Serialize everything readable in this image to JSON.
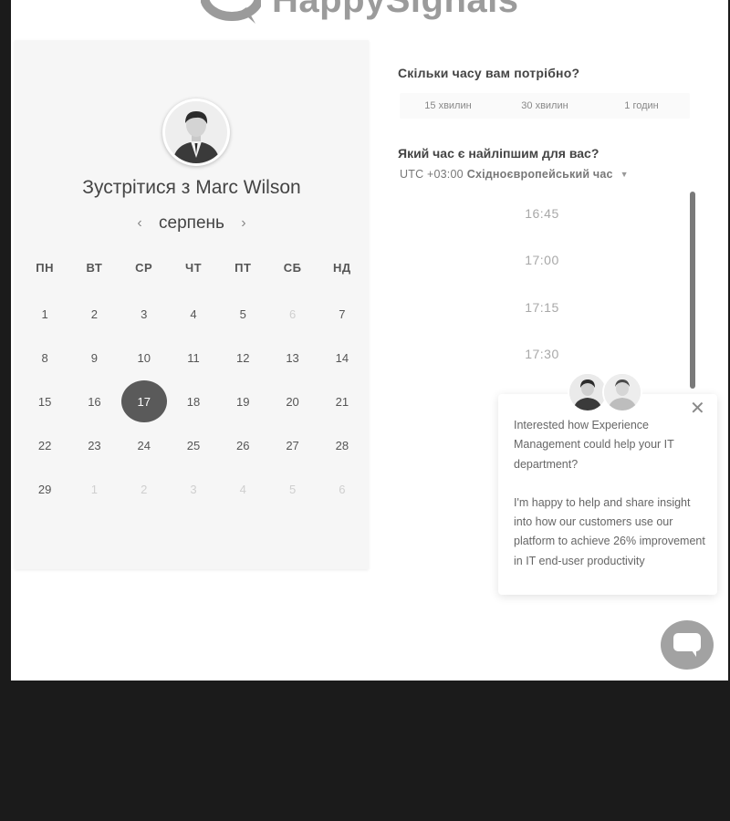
{
  "brand": {
    "name": "HappySignals"
  },
  "calendar": {
    "title": "Зустрітися з Marc Wilson",
    "month": "серпень",
    "prev_icon": "chevron-left-icon",
    "next_icon": "chevron-right-icon",
    "weekdays": [
      "ПН",
      "ВТ",
      "СР",
      "ЧТ",
      "ПТ",
      "СБ",
      "НД"
    ],
    "weeks": [
      [
        "1",
        "2",
        "3",
        "4",
        "5",
        "6",
        "7"
      ],
      [
        "8",
        "9",
        "10",
        "11",
        "12",
        "13",
        "14"
      ],
      [
        "15",
        "16",
        "17",
        "18",
        "19",
        "20",
        "21"
      ],
      [
        "22",
        "23",
        "24",
        "25",
        "26",
        "27",
        "28"
      ],
      [
        "29",
        "1",
        "2",
        "3",
        "4",
        "5",
        "6"
      ]
    ],
    "selected_day": "17"
  },
  "duration": {
    "question": "Скільки часу вам потрібно?",
    "options": [
      "15 хвилин",
      "30 хвилин",
      "1 годин"
    ]
  },
  "timeslot": {
    "question": "Який час є найліпшим для вас?",
    "tz_offset": "UTC +03:00",
    "tz_name": "Східноєвропейський час",
    "times": [
      "16:45",
      "17:00",
      "17:15",
      "17:30"
    ]
  },
  "chat": {
    "message_1": "Interested how Experience Management could help your IT department?",
    "message_2": "I'm happy to help and share insight into how our customers use our platform to achieve 26% improvement in IT end-user productivity",
    "close_icon": "close-icon",
    "launcher_icon": "chat-bubble-icon"
  },
  "colors": {
    "selected_day": "#5a5a5a",
    "scrollbar": "#7a7a7a",
    "launcher": "#a2a2a2"
  }
}
